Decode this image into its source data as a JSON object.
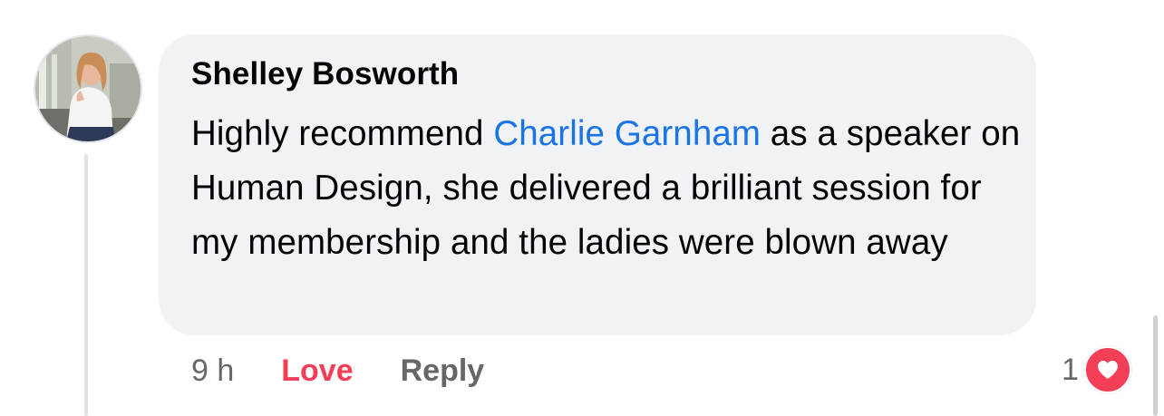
{
  "comment": {
    "author": "Shelley Bosworth",
    "text_before_mention": "Highly recommend ",
    "mention": "Charlie Garnham",
    "text_after_mention": " as a speaker on Human Design, she delivered a brilliant session for my membership and the ladies were blown away",
    "timestamp": "9 h",
    "love_label": "Love",
    "reply_label": "Reply",
    "reaction_count": "1",
    "reaction_icon": "heart-icon"
  },
  "colors": {
    "bubble": "#f0f2f5",
    "mention": "#1b74e4",
    "love": "#f33e58",
    "secondary_text": "#65676b"
  }
}
